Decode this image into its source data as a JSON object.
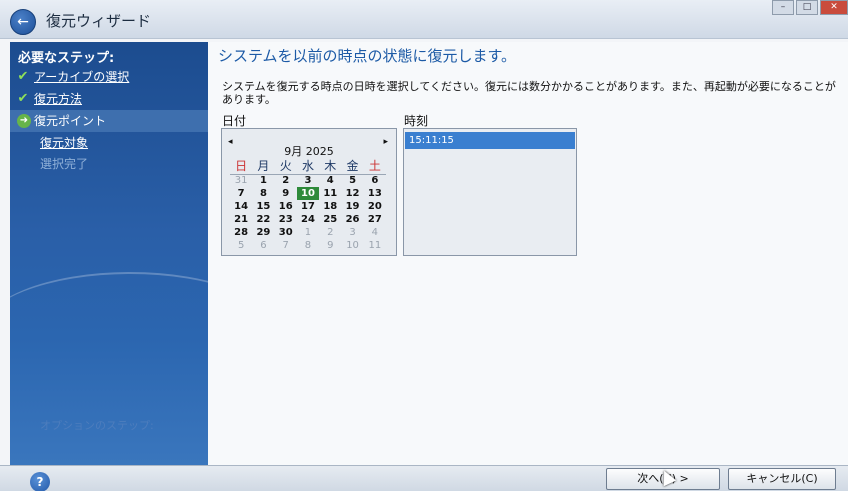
{
  "window": {
    "title": "復元ウィザード",
    "back_icon": "back-arrow-icon",
    "controls": [
      "minimize",
      "maximize",
      "close"
    ]
  },
  "sidebar": {
    "heading": "必要なステップ:",
    "items": [
      {
        "label": "アーカイブの選択",
        "state": "done"
      },
      {
        "label": "復元方法",
        "state": "done"
      },
      {
        "label": "復元ポイント",
        "state": "current"
      },
      {
        "label": "復元対象",
        "state": "link"
      },
      {
        "label": "選択完了",
        "state": "disabled"
      }
    ],
    "footer": "オプションのステップ:"
  },
  "main": {
    "heading": "システムを以前の時点の状態に復元します。",
    "description": "システムを復元する時点の日時を選択してください。復元には数分かかることがあります。また、再起動が必要になることがあります。",
    "date_label": "日付",
    "time_label": "時刻"
  },
  "calendar": {
    "prev": "◂",
    "next": "▸",
    "month": "9月 2025",
    "weekdays": [
      "日",
      "月",
      "火",
      "水",
      "木",
      "金",
      "土"
    ],
    "days": [
      {
        "d": "31",
        "o": true
      },
      {
        "d": "1"
      },
      {
        "d": "2"
      },
      {
        "d": "3"
      },
      {
        "d": "4"
      },
      {
        "d": "5"
      },
      {
        "d": "6"
      },
      {
        "d": "7"
      },
      {
        "d": "8"
      },
      {
        "d": "9"
      },
      {
        "d": "10",
        "sel": true
      },
      {
        "d": "11"
      },
      {
        "d": "12"
      },
      {
        "d": "13"
      },
      {
        "d": "14"
      },
      {
        "d": "15"
      },
      {
        "d": "16"
      },
      {
        "d": "17"
      },
      {
        "d": "18"
      },
      {
        "d": "19"
      },
      {
        "d": "20"
      },
      {
        "d": "21"
      },
      {
        "d": "22"
      },
      {
        "d": "23"
      },
      {
        "d": "24"
      },
      {
        "d": "25"
      },
      {
        "d": "26"
      },
      {
        "d": "27"
      },
      {
        "d": "28"
      },
      {
        "d": "29"
      },
      {
        "d": "30"
      },
      {
        "d": "1",
        "o": true
      },
      {
        "d": "2",
        "o": true
      },
      {
        "d": "3",
        "o": true
      },
      {
        "d": "4",
        "o": true
      },
      {
        "d": "5",
        "o": true
      },
      {
        "d": "6",
        "o": true
      },
      {
        "d": "7",
        "o": true
      },
      {
        "d": "8",
        "o": true
      },
      {
        "d": "9",
        "o": true
      },
      {
        "d": "10",
        "o": true
      },
      {
        "d": "11",
        "o": true
      }
    ]
  },
  "times": [
    "15:11:15"
  ],
  "buttons": {
    "next": "次へ(N) >",
    "cancel": "キャンセル(C)",
    "help_icon": "help-icon"
  },
  "colors": {
    "sidebar": "#2a5fa8",
    "heading": "#1c5aa6",
    "selected_day": "#2e8a3a",
    "selected_time": "#3a7fd0",
    "sunday_saturday": "#cc3333"
  }
}
